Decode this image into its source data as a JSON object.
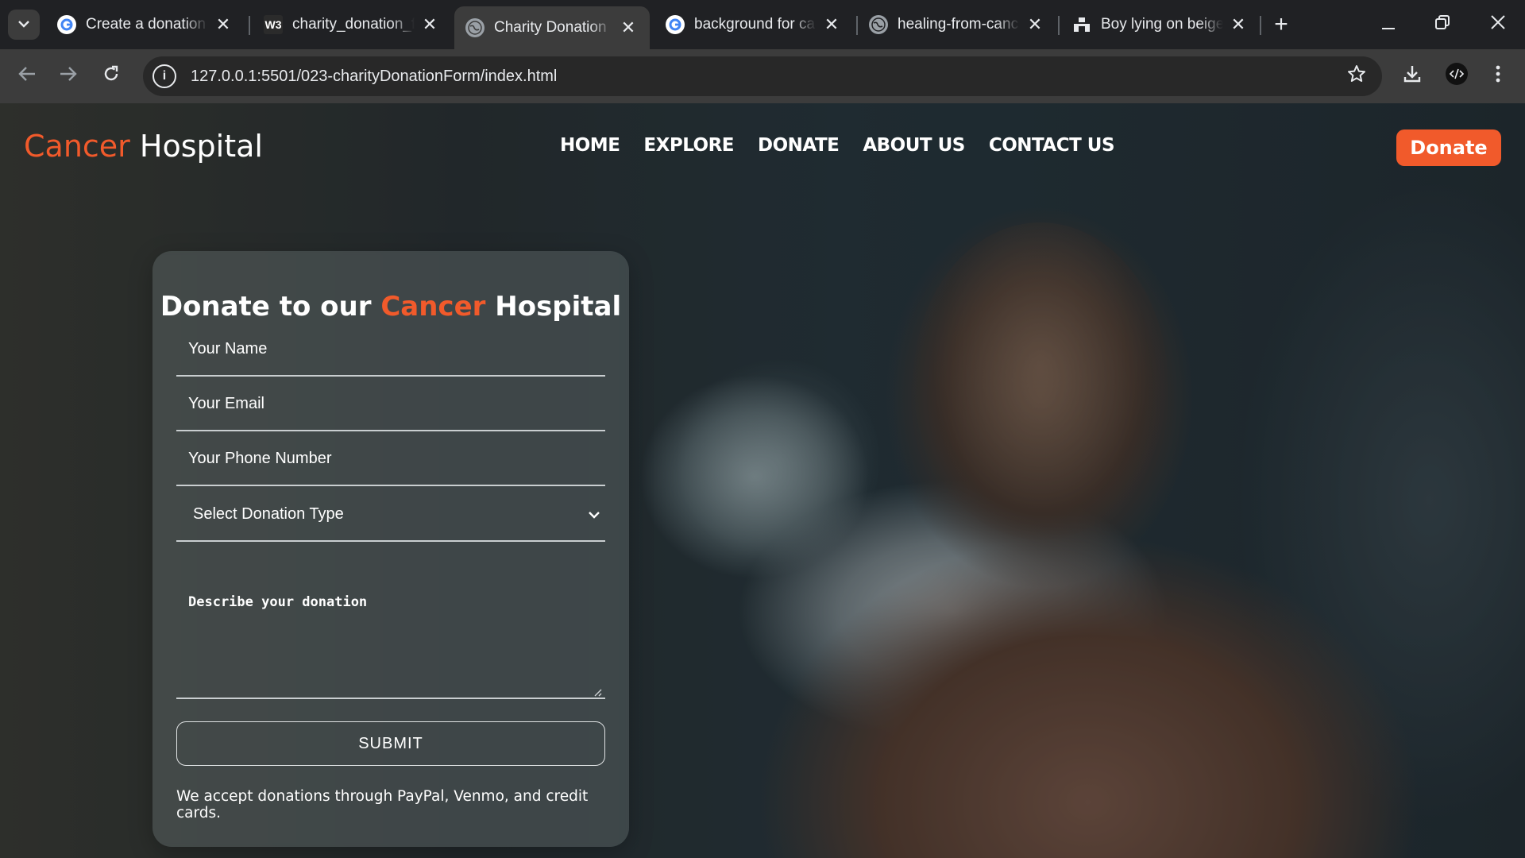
{
  "browser": {
    "tabs": [
      {
        "title": "Create a donation",
        "favicon": "google-icon",
        "active": false
      },
      {
        "title": "charity_donation_f",
        "favicon": "w3layouts-icon",
        "active": false
      },
      {
        "title": "Charity Donation",
        "favicon": "globe-icon",
        "active": true
      },
      {
        "title": "background for ca",
        "favicon": "google-icon",
        "active": false
      },
      {
        "title": "healing-from-canc",
        "favicon": "globe-icon",
        "active": false
      },
      {
        "title": "Boy lying on beige",
        "favicon": "unsplash-icon",
        "active": false
      }
    ],
    "w3_badge": "W3",
    "url": "127.0.0.1:5501/023-charityDonationForm/index.html"
  },
  "site": {
    "logo_accent": "Cancer",
    "logo_rest": " Hospital",
    "nav": [
      "HOME",
      "EXPLORE",
      "DONATE",
      "ABOUT US",
      "CONTACT US"
    ],
    "cta_label": "Donate"
  },
  "form": {
    "title_prefix": "Donate to our ",
    "title_accent": "Cancer",
    "title_suffix": " Hospital",
    "name_placeholder": "Your Name",
    "email_placeholder": "Your Email",
    "phone_placeholder": "Your Phone Number",
    "donation_type_selected": "Select Donation Type",
    "description_placeholder": "Describe your donation",
    "submit_label": "SUBMIT",
    "note": "We accept donations through PayPal, Venmo, and credit cards."
  },
  "colors": {
    "accent": "#f15a2b",
    "chrome_dark": "#202124",
    "chrome_toolbar": "#3c3c3c"
  }
}
